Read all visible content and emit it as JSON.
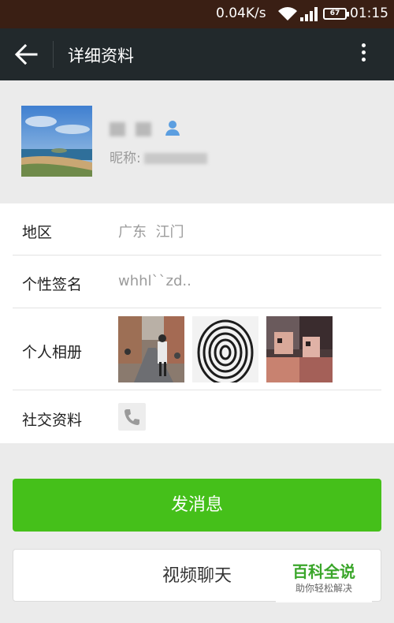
{
  "status_bar": {
    "net_speed": "0.04K/s",
    "battery_level": "67",
    "time": "01:15"
  },
  "header": {
    "title": "详细资料"
  },
  "profile": {
    "nickname_label": "昵称:"
  },
  "details": {
    "region_label": "地区",
    "region_value": "广东  江门",
    "signature_label": "个性签名",
    "signature_value": "whhl``zd..",
    "album_label": "个人相册",
    "social_label": "社交资料"
  },
  "actions": {
    "send_message": "发消息",
    "video_chat": "视频聊天"
  },
  "watermark": {
    "title": "百科全说",
    "subtitle": "助你轻松解决"
  },
  "colors": {
    "status_bar_bg": "#3a1f14",
    "title_bar_bg": "#22292c",
    "primary_green": "#45c01a",
    "user_icon_blue": "#5b9ee0"
  }
}
